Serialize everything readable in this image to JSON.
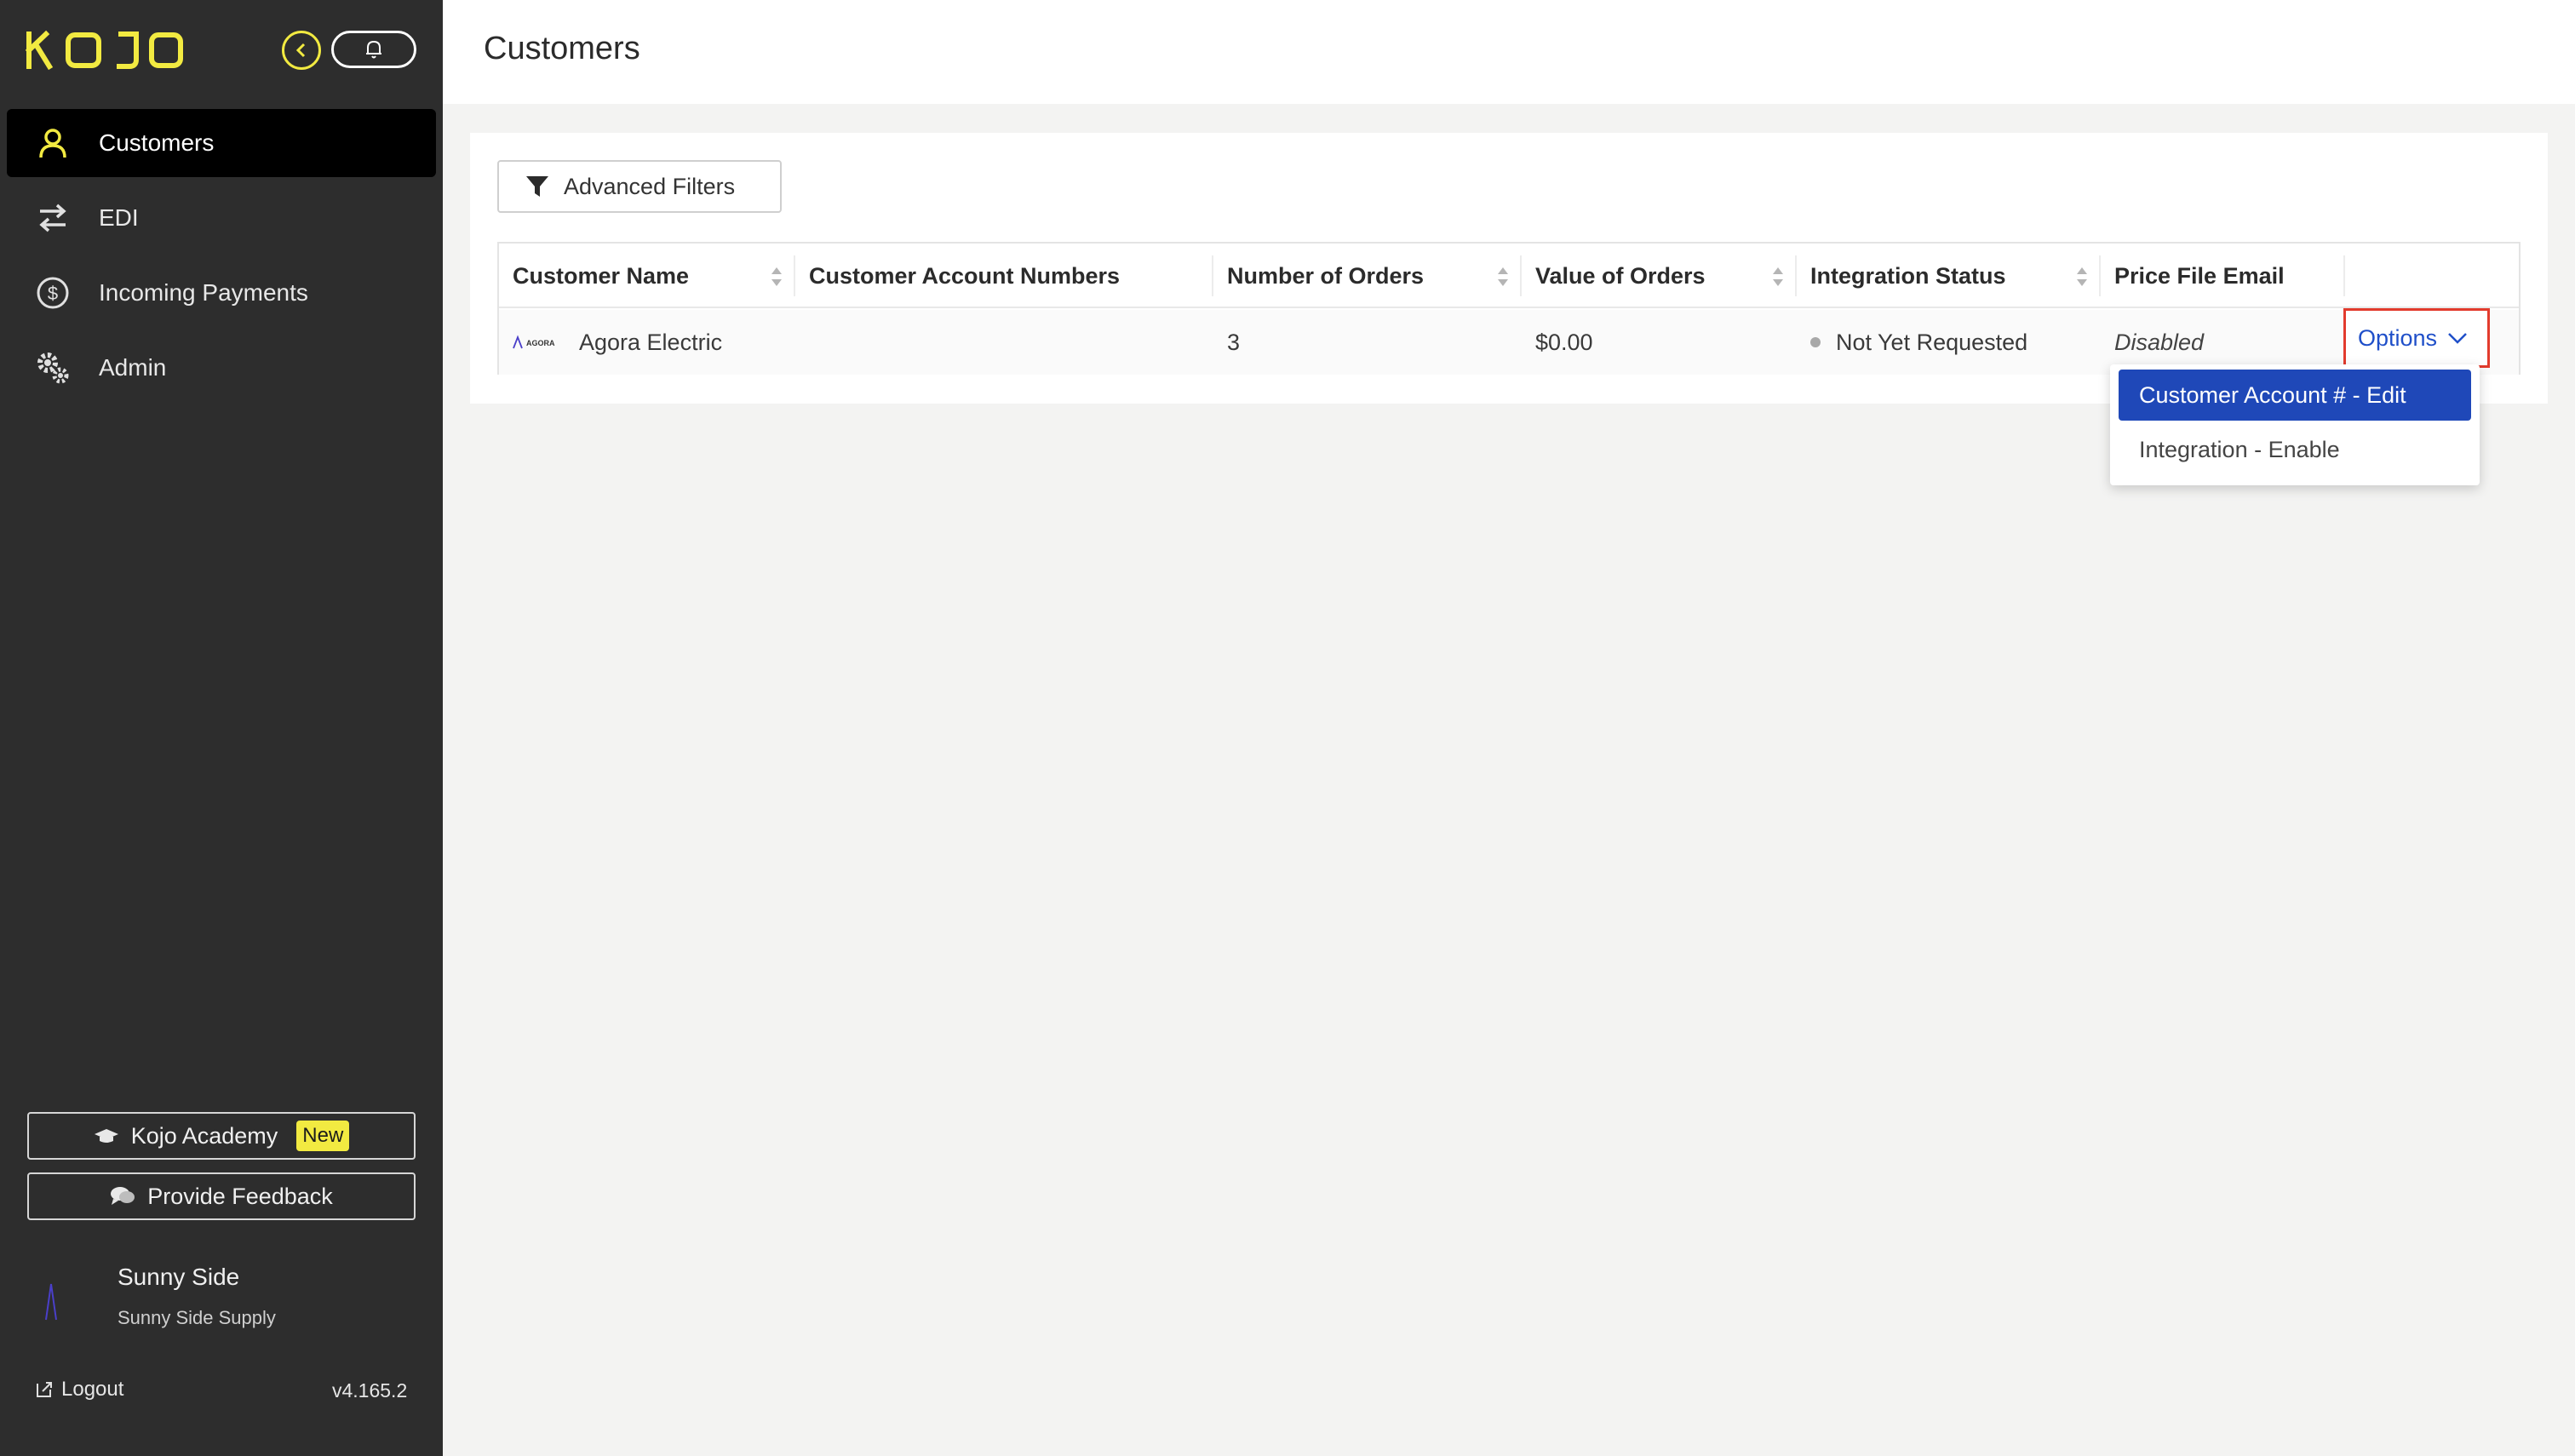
{
  "brand": {
    "logo_text": "KOJO",
    "accent": "#f2ea41"
  },
  "sidebar": {
    "items": [
      {
        "label": "Customers",
        "icon": "user-icon",
        "active": true
      },
      {
        "label": "EDI",
        "icon": "transfer-arrows-icon",
        "active": false
      },
      {
        "label": "Incoming Payments",
        "icon": "dollar-circle-icon",
        "active": false
      },
      {
        "label": "Admin",
        "icon": "gears-icon",
        "active": false
      }
    ],
    "academy_label": "Kojo Academy",
    "academy_badge": "New",
    "feedback_label": "Provide Feedback",
    "account_name": "Sunny Side",
    "account_company": "Sunny Side Supply",
    "logout_label": "Logout",
    "version": "v4.165.2"
  },
  "header": {
    "title": "Customers"
  },
  "filters": {
    "label": "Advanced Filters"
  },
  "table": {
    "columns": [
      "Customer Name",
      "Customer Account Numbers",
      "Number of Orders",
      "Value of Orders",
      "Integration Status",
      "Price File Email"
    ],
    "rows": [
      {
        "logo_text": "AGORA",
        "customer_name": "Agora Electric",
        "account_numbers": "",
        "orders": "3",
        "value": "$0.00",
        "integration_status": "Not Yet Requested",
        "price_file_email": "Disabled",
        "options_label": "Options"
      }
    ]
  },
  "dropdown": {
    "items": [
      "Customer Account # - Edit",
      "Integration - Enable"
    ]
  }
}
